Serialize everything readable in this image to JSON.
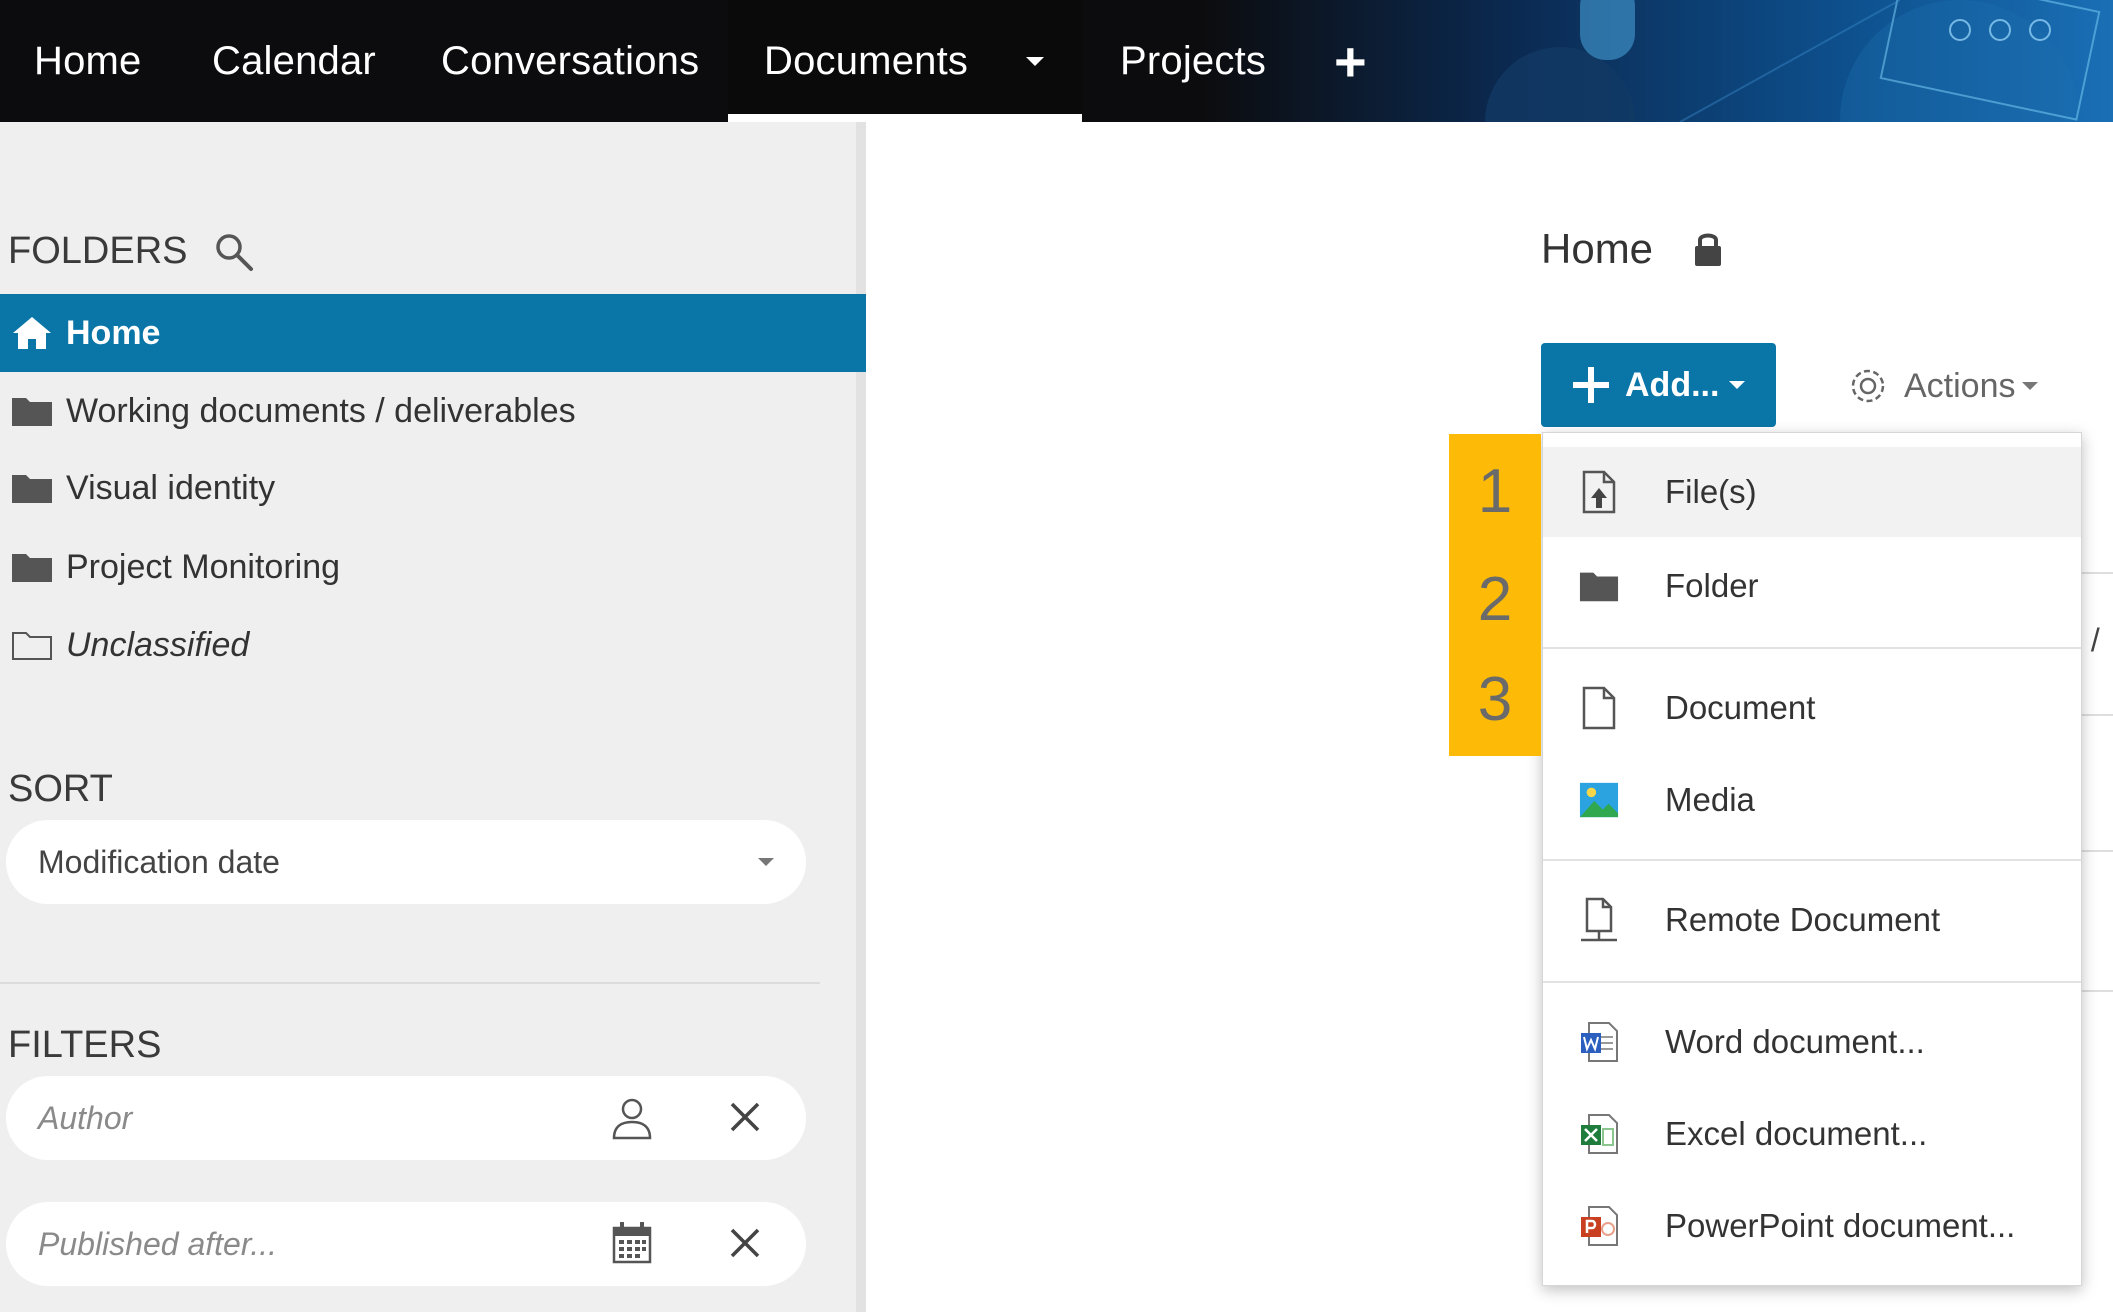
{
  "nav": {
    "items": [
      "Home",
      "Calendar",
      "Conversations",
      "Documents",
      "Projects"
    ],
    "add_tab_symbol": "+"
  },
  "sidebar": {
    "folders_title": "FOLDERS",
    "folders": [
      {
        "label": "Home",
        "icon": "home-icon",
        "active": true
      },
      {
        "label": "Working documents / deliverables",
        "icon": "folder-icon"
      },
      {
        "label": "Visual identity",
        "icon": "folder-icon"
      },
      {
        "label": "Project Monitoring",
        "icon": "folder-icon"
      },
      {
        "label": "Unclassified",
        "icon": "folder-outline-icon"
      }
    ],
    "sort_title": "SORT",
    "sort_value": "Modification date",
    "filters_title": "FILTERS",
    "author_placeholder": "Author",
    "published_placeholder": "Published after..."
  },
  "main": {
    "breadcrumb": "Home",
    "add_label": "Add...",
    "actions_label": "Actions",
    "background_fragment": "s /"
  },
  "menu": {
    "items": [
      {
        "label": "File(s)",
        "icon": "file-upload-icon"
      },
      {
        "label": "Folder",
        "icon": "folder-icon"
      },
      {
        "label": "Document",
        "icon": "document-icon"
      },
      {
        "label": "Media",
        "icon": "media-image-icon"
      },
      {
        "label": "Remote Document",
        "icon": "remote-document-icon"
      },
      {
        "label": "Word document...",
        "icon": "word-icon"
      },
      {
        "label": "Excel document...",
        "icon": "excel-icon"
      },
      {
        "label": "PowerPoint document...",
        "icon": "powerpoint-icon"
      }
    ]
  },
  "callouts": [
    "1",
    "2",
    "3"
  ],
  "colors": {
    "accent_blue": "#0a76a8",
    "callout_yellow": "#fdbb07",
    "nav_bg": "#0c0c0e",
    "sidebar_bg": "#efefef"
  }
}
